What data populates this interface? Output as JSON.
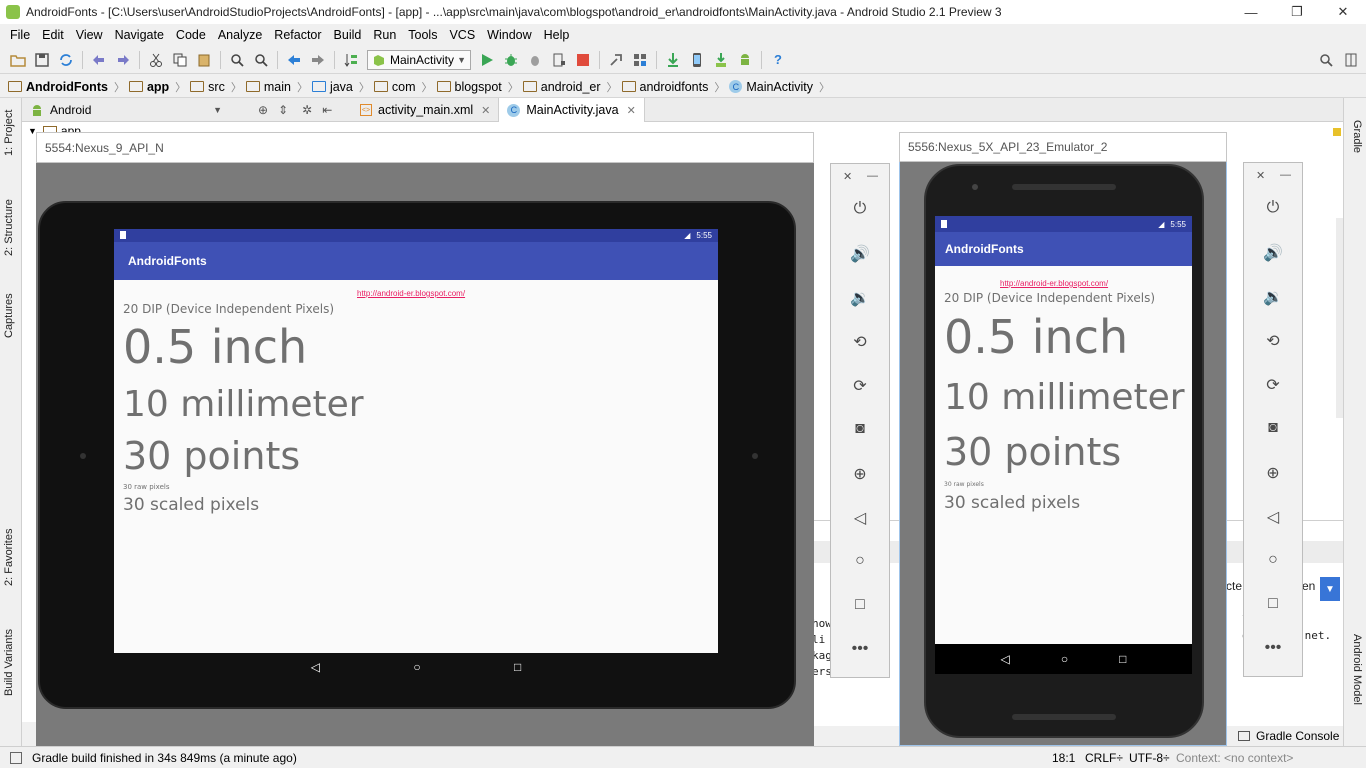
{
  "window": {
    "title": "AndroidFonts - [C:\\Users\\user\\AndroidStudioProjects\\AndroidFonts] - [app] - ...\\app\\src\\main\\java\\com\\blogspot\\android_er\\androidfonts\\MainActivity.java - Android Studio 2.1 Preview 3",
    "controls": [
      "—",
      "❐",
      "✕"
    ]
  },
  "menu": [
    "File",
    "Edit",
    "View",
    "Navigate",
    "Code",
    "Analyze",
    "Refactor",
    "Build",
    "Run",
    "Tools",
    "VCS",
    "Window",
    "Help"
  ],
  "toolbar": {
    "run_config": "MainActivity",
    "help": "?"
  },
  "breadcrumb": [
    "AndroidFonts",
    "app",
    "src",
    "main",
    "java",
    "com",
    "blogspot",
    "android_er",
    "androidfonts",
    "MainActivity"
  ],
  "project_panel": {
    "view": "Android",
    "root": "app"
  },
  "editor_tabs": [
    {
      "label": "activity_main.xml",
      "active": false
    },
    {
      "label": "MainActivity.java",
      "active": true
    }
  ],
  "left_tabs": [
    "1: Project",
    "2: Structure",
    "Captures",
    "2: Favorites",
    "Build Variants"
  ],
  "right_tabs": [
    "Gradle",
    "Android Model"
  ],
  "editor_fragments": {
    "line1": "how",
    "line2": "li",
    "line3": "kag",
    "line4": "ers",
    "right1": "li",
    "right2": "on",
    "right3": ".net.",
    "combo_text": "cte",
    "combo_text2": "en"
  },
  "emulators": [
    {
      "title": "5554:Nexus_9_API_N",
      "status_time": "5:55",
      "app_title": "AndroidFonts",
      "link": "http://android-er.blogspot.com/",
      "lines": [
        "20 DIP (Device Independent Pixels)",
        "0.5 inch",
        "10 millimeter",
        "30 points",
        "30 raw pixels",
        "30 scaled pixels"
      ]
    },
    {
      "title": "5556:Nexus_5X_API_23_Emulator_2",
      "status_time": "5:55",
      "app_title": "AndroidFonts",
      "link": "http://android-er.blogspot.com/",
      "lines": [
        "20 DIP (Device Independent Pixels)",
        "0.5 inch",
        "10 millimeter",
        "30 points",
        "30 raw pixels",
        "30 scaled pixels"
      ]
    }
  ],
  "emulator_controls": [
    "close",
    "minimize",
    "power",
    "volume-up",
    "volume-down",
    "rotate-left",
    "rotate-right",
    "screenshot",
    "zoom",
    "back",
    "home",
    "overview",
    "more"
  ],
  "status": {
    "message": "Gradle build finished in 34s 849ms (a minute ago)",
    "position": "18:1",
    "line_sep": "CRLF÷",
    "encoding": "UTF-8÷",
    "context": "Context: <no context>"
  },
  "gradle_console": "Gradle Console",
  "colors": {
    "primary": "#3f51b5",
    "primary_dark": "#303f9f",
    "link": "#e91e63"
  }
}
